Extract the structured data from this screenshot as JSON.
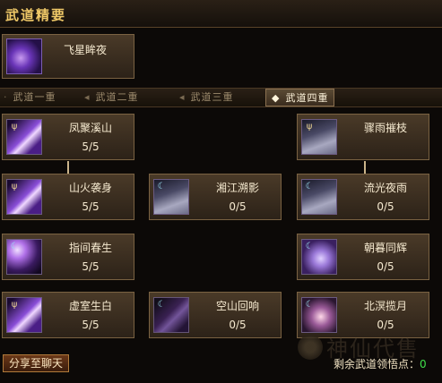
{
  "window": {
    "title": "武道精要"
  },
  "feature": {
    "name": "飞星眸夜"
  },
  "tabs": [
    {
      "label": "武道一重",
      "active": false
    },
    {
      "label": "武道二重",
      "active": false
    },
    {
      "label": "武道三重",
      "active": false
    },
    {
      "label": "武道四重",
      "active": true
    }
  ],
  "skills": [
    {
      "name": "凤聚溪山",
      "level": "5/5"
    },
    {
      "name": "骤雨摧枝",
      "level": ""
    },
    {
      "name": "山火袭身",
      "level": "5/5"
    },
    {
      "name": "湘江溯影",
      "level": "0/5"
    },
    {
      "name": "流光夜雨",
      "level": "0/5"
    },
    {
      "name": "指间春生",
      "level": "5/5"
    },
    {
      "name": "朝暮同辉",
      "level": "0/5"
    },
    {
      "name": "虚室生白",
      "level": "5/5"
    },
    {
      "name": "空山回响",
      "level": "0/5"
    },
    {
      "name": "北溟揽月",
      "level": "0/5"
    }
  ],
  "footer": {
    "share_label": "分享至聊天",
    "remain_label": "剩余武道领悟点：",
    "remain_value": "0"
  },
  "watermark": "神仙代售",
  "colors": {
    "accent": "#f0c968",
    "positive": "#3fe04a"
  }
}
